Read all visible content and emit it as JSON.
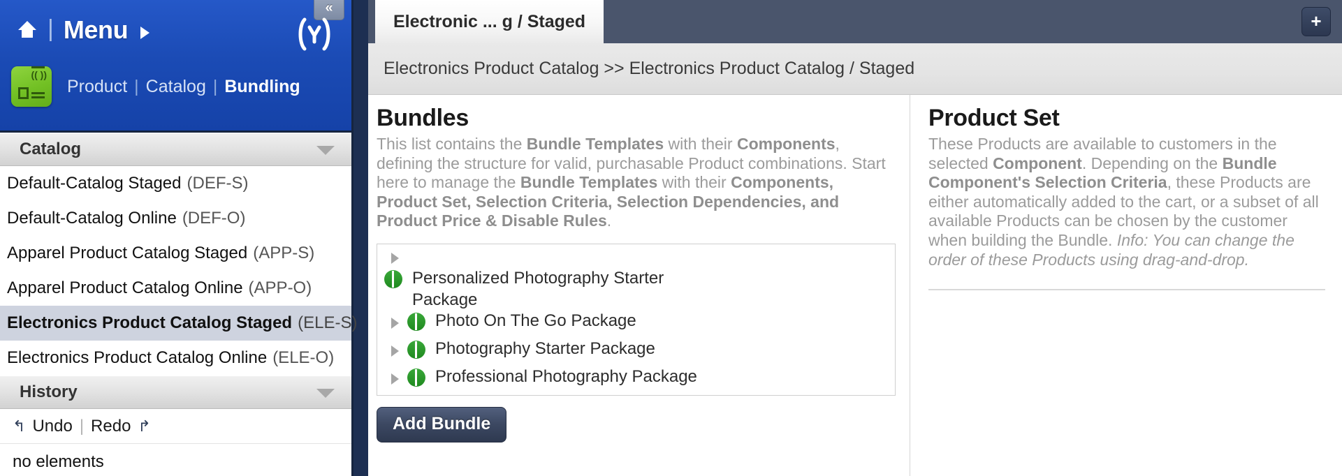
{
  "sidebar": {
    "collapse_label": "«",
    "menu_label": "Menu",
    "home_icon": "home-icon",
    "logo_glyph": "⑂",
    "app_icon": "catalog-app-icon",
    "breadcrumb": {
      "product": "Product",
      "catalog": "Catalog",
      "bundling": "Bundling",
      "separator": "|"
    },
    "catalog_section": {
      "title": "Catalog",
      "items": [
        {
          "name": "Default-Catalog Staged",
          "code": "(DEF-S)",
          "selected": false
        },
        {
          "name": "Default-Catalog Online",
          "code": "(DEF-O)",
          "selected": false
        },
        {
          "name": "Apparel Product Catalog Staged",
          "code": "(APP-S)",
          "selected": false
        },
        {
          "name": "Apparel Product Catalog Online",
          "code": "(APP-O)",
          "selected": false
        },
        {
          "name": "Electronics Product Catalog Staged",
          "code": "(ELE-S)",
          "selected": true
        },
        {
          "name": "Electronics Product Catalog Online",
          "code": "(ELE-O)",
          "selected": false
        }
      ]
    },
    "history_section": {
      "title": "History",
      "undo_label": "Undo",
      "redo_label": "Redo",
      "undo_icon": "undo-arrow-icon",
      "redo_icon": "redo-arrow-icon",
      "separator": "|",
      "empty_text": "no elements"
    }
  },
  "main": {
    "tab_label": "Electronic ... g / Staged",
    "add_tab_label": "+",
    "breadcrumb_text": "Electronics Product Catalog >> Electronics Product Catalog / Staged",
    "bundles_panel": {
      "title": "Bundles",
      "description_parts": [
        {
          "text": "This list contains the ",
          "bold": false
        },
        {
          "text": "Bundle Templates",
          "bold": true
        },
        {
          "text": " with their ",
          "bold": false
        },
        {
          "text": "Components",
          "bold": true
        },
        {
          "text": ", defining the structure for valid, purchasable Product combinations. Start here to manage the ",
          "bold": false
        },
        {
          "text": "Bundle Templates",
          "bold": true
        },
        {
          "text": " with their ",
          "bold": false
        },
        {
          "text": "Components, Product Set, Selection Criteria, Selection Dependencies, and Product Price & Disable Rules",
          "bold": true
        },
        {
          "text": ".",
          "bold": false
        }
      ],
      "items": [
        {
          "name": "Personalized Photography Starter Package",
          "icon": "bundle-icon",
          "expand_icon": "expand-triangle-icon"
        },
        {
          "name": "Photo On The Go Package",
          "icon": "bundle-icon",
          "expand_icon": "expand-triangle-icon"
        },
        {
          "name": "Photography Starter Package",
          "icon": "bundle-icon",
          "expand_icon": "expand-triangle-icon"
        },
        {
          "name": "Professional Photography Package",
          "icon": "bundle-icon",
          "expand_icon": "expand-triangle-icon"
        }
      ],
      "add_button_label": "Add Bundle"
    },
    "product_set_panel": {
      "title": "Product Set",
      "description_parts": [
        {
          "text": "These Products are available to customers in the selected ",
          "bold": false,
          "italic": false
        },
        {
          "text": "Component",
          "bold": true,
          "italic": false
        },
        {
          "text": ". Depending on the ",
          "bold": false,
          "italic": false
        },
        {
          "text": "Bundle Component's Selection Criteria",
          "bold": true,
          "italic": false
        },
        {
          "text": ", these Products are either automatically added to the cart, or a subset of all available Products can be chosen by the customer when building the Bundle. ",
          "bold": false,
          "italic": false
        },
        {
          "text": "Info: You can change the order of these Products using drag-and-drop.",
          "bold": false,
          "italic": true
        }
      ]
    }
  },
  "colors": {
    "brand_blue": "#1b4bb5",
    "header_slate": "#4a556c",
    "sidebar_navy": "#1d2f52",
    "accent_green": "#1f8a1f",
    "selected_row": "#ced3df"
  }
}
